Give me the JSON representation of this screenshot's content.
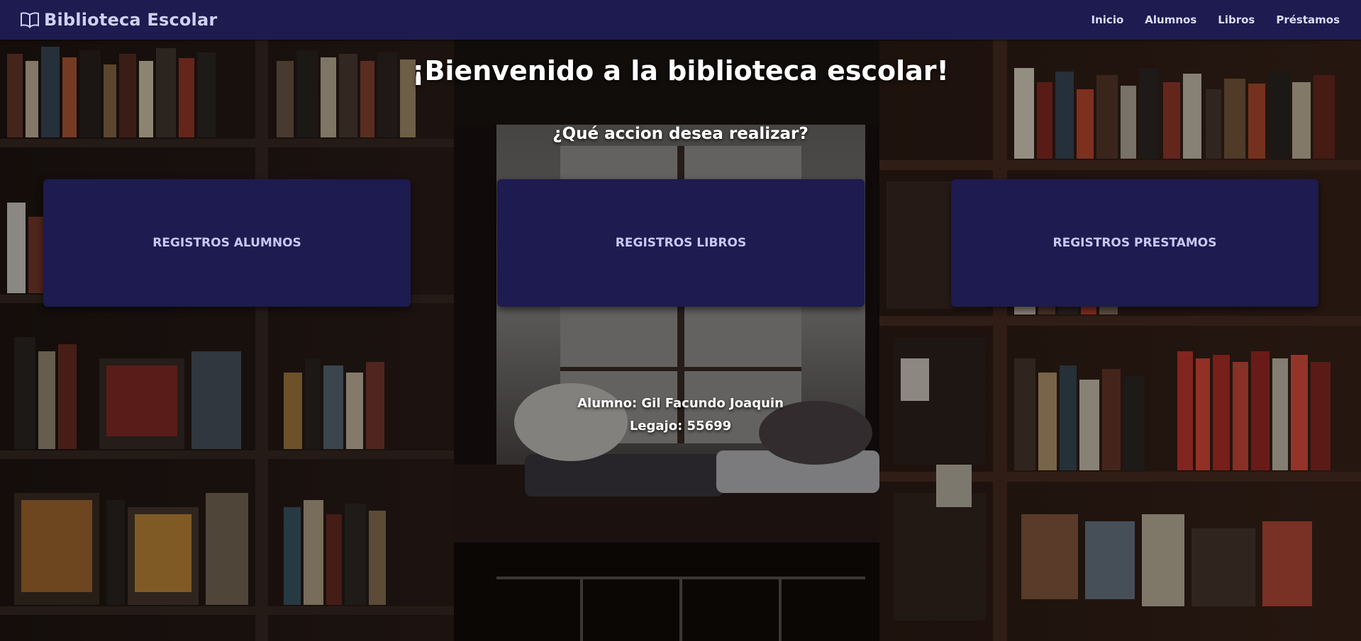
{
  "navbar": {
    "brand": "Biblioteca Escolar",
    "brand_icon": "book-open-icon",
    "links": [
      "Inicio",
      "Alumnos",
      "Libros",
      "Préstamos"
    ],
    "background": "#1d1b4f"
  },
  "main": {
    "title": "¡Bienvenido a la biblioteca escolar!",
    "subtitle": "¿Qué accion desea realizar?",
    "cards": [
      "REGISTROS ALUMNOS",
      "REGISTROS LIBROS",
      "REGISTROS PRESTAMOS"
    ]
  },
  "footer": {
    "student": "Alumno: Gil Facundo Joaquin",
    "legajo": "Legajo: 55699"
  },
  "colors": {
    "accent": "#1d1b4f",
    "card_text": "#c7c8f3"
  }
}
